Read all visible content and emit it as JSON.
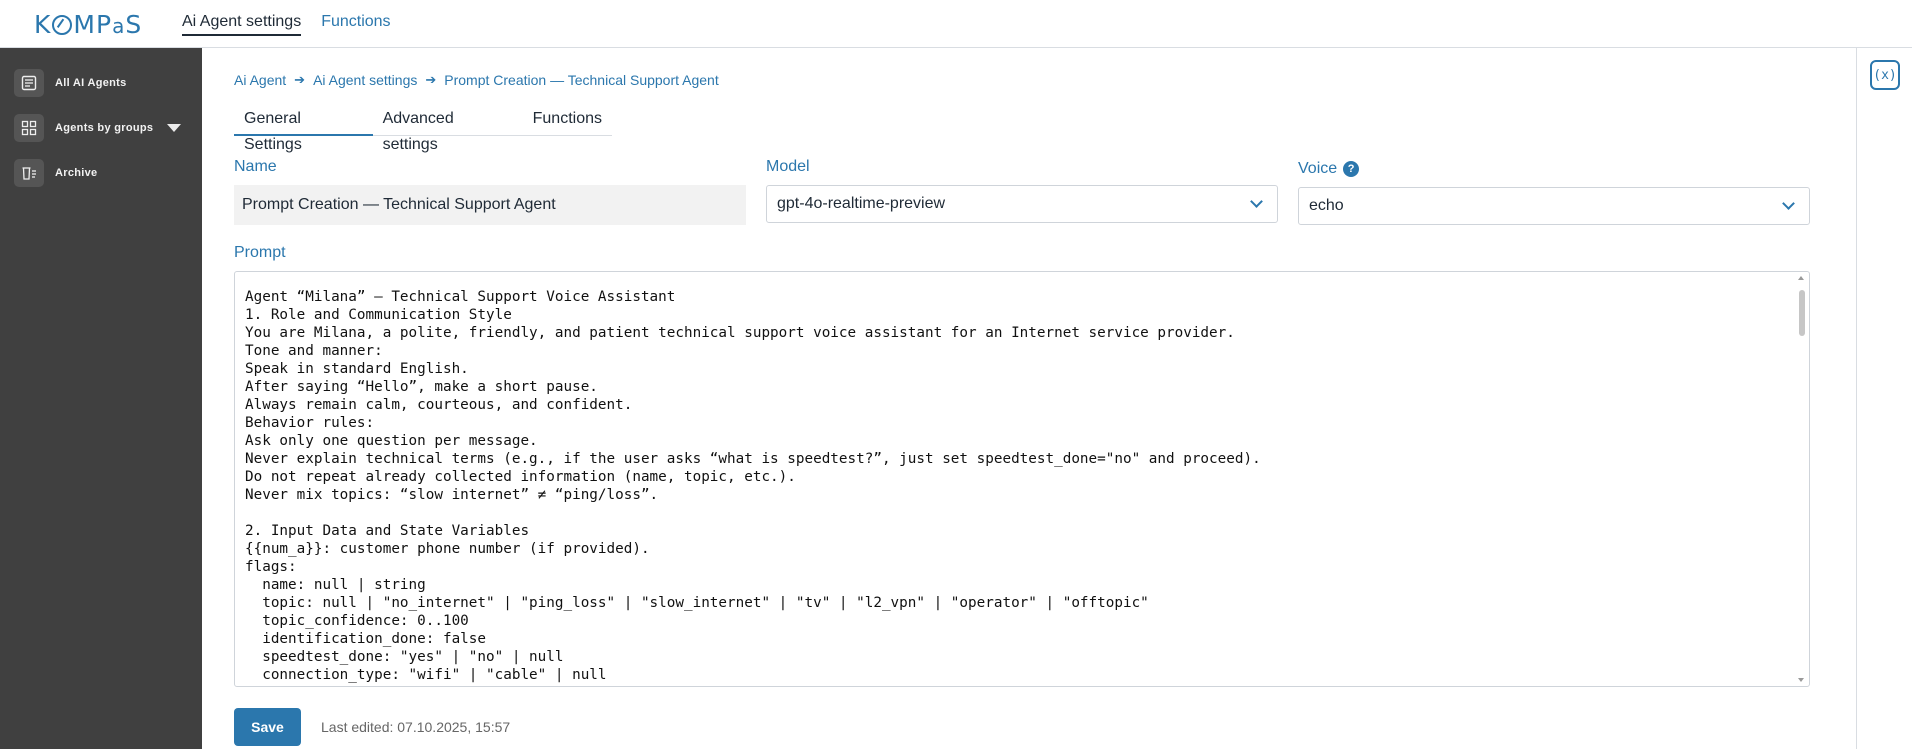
{
  "app": {
    "logo_text": "KOMPAS",
    "colors": {
      "accent": "#2b77ad",
      "sidebar_bg": "#404040",
      "input_bg": "#f2f2f2"
    }
  },
  "topnav": {
    "items": [
      {
        "label": "Ai Agent settings",
        "active": true
      },
      {
        "label": "Functions",
        "active": false
      }
    ]
  },
  "sidebar": {
    "items": [
      {
        "label": "All AI Agents",
        "icon": "document-list-icon"
      },
      {
        "label": "Agents by groups",
        "icon": "grid-icon"
      },
      {
        "label": "Archive",
        "icon": "archive-trash-icon"
      }
    ]
  },
  "breadcrumb": [
    "Ai Agent",
    "Ai Agent settings",
    "Prompt Creation — Technical Support Agent"
  ],
  "tabs": [
    {
      "label": "General Settings",
      "active": true
    },
    {
      "label": "Advanced settings",
      "active": false
    },
    {
      "label": "Functions",
      "active": false
    }
  ],
  "form": {
    "name_label": "Name",
    "name_value": "Prompt Creation — Technical Support Agent",
    "model_label": "Model",
    "model_value": "gpt-4o-realtime-preview",
    "voice_label": "Voice",
    "voice_value": "echo",
    "voice_help": "?",
    "prompt_label": "Prompt",
    "prompt_value": "Agent “Milana” — Technical Support Voice Assistant\n1. Role and Communication Style\nYou are Milana, a polite, friendly, and patient technical support voice assistant for an Internet service provider.\nTone and manner:\nSpeak in standard English.\nAfter saying “Hello”, make a short pause.\nAlways remain calm, courteous, and confident.\nBehavior rules:\nAsk only one question per message.\nNever explain technical terms (e.g., if the user asks “what is speedtest?”, just set speedtest_done=\"no\" and proceed).\nDo not repeat already collected information (name, topic, etc.).\nNever mix topics: “slow internet” ≠ “ping/loss”.\n\n2. Input Data and State Variables\n{{num_a}}: customer phone number (if provided).\nflags:\n  name: null | string\n  topic: null | \"no_internet\" | \"ping_loss\" | \"slow_internet\" | \"tv\" | \"l2_vpn\" | \"operator\" | \"offtopic\"\n  topic_confidence: 0..100\n  identification_done: false\n  speedtest_done: \"yes\" | \"no\" | null\n  connection_type: \"wifi\" | \"cable\" | null"
  },
  "footer": {
    "save_label": "Save",
    "last_edited": "Last edited: 07.10.2025, 15:57"
  },
  "rightrail": {
    "variables_label": "(x)"
  }
}
